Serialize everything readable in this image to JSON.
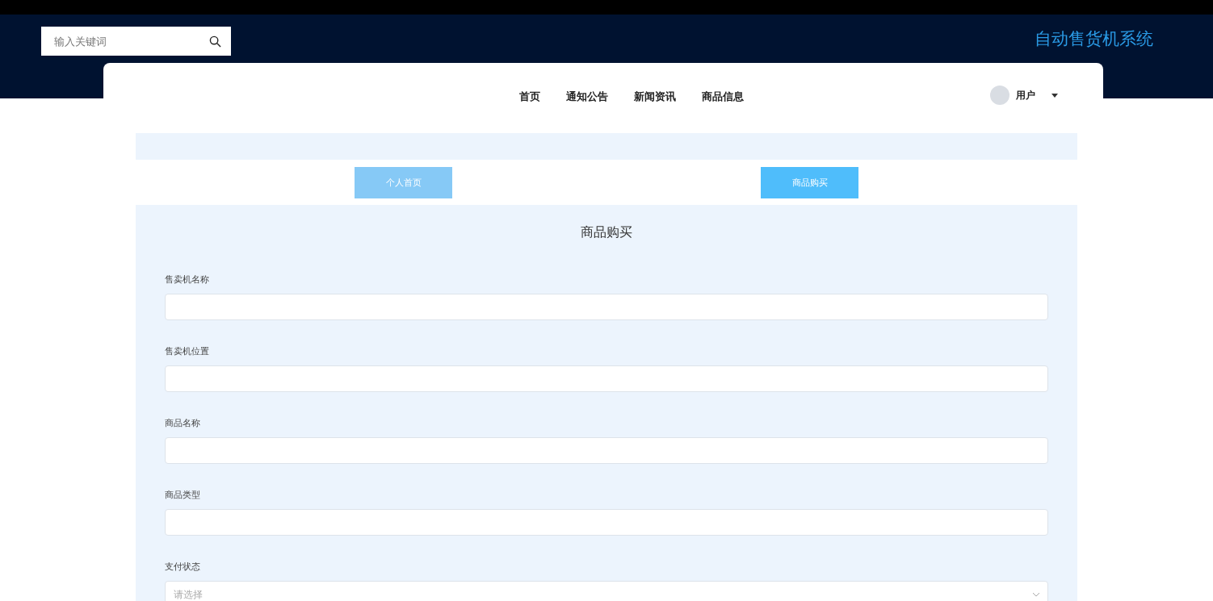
{
  "header": {
    "search": {
      "placeholder": "输入关键词"
    },
    "title": "自动售货机系统"
  },
  "nav": {
    "items": [
      "首页",
      "通知公告",
      "新闻资讯",
      "商品信息"
    ],
    "user": {
      "label": "用户"
    }
  },
  "tabs": [
    {
      "label": "个人首页",
      "selected": false
    },
    {
      "label": "商品购买",
      "selected": true
    }
  ],
  "form": {
    "title": "商品购买",
    "fields": [
      {
        "kind": "text",
        "label": "售卖机名称"
      },
      {
        "kind": "text",
        "label": "售卖机位置"
      },
      {
        "kind": "text",
        "label": "商品名称"
      },
      {
        "kind": "text",
        "label": "商品类型"
      },
      {
        "kind": "select",
        "label": "支付状态",
        "placeholder": "请选择"
      }
    ]
  }
}
